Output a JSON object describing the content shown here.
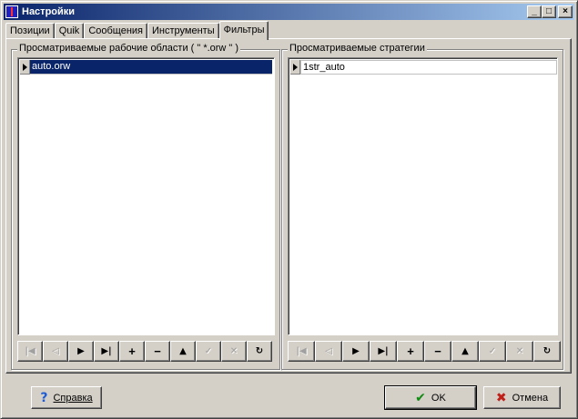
{
  "window": {
    "title": "Настройки",
    "controls": {
      "minimize": "_",
      "maximize": "□",
      "close": "×"
    }
  },
  "tabs": [
    {
      "label": "Позиции"
    },
    {
      "label": "Quik"
    },
    {
      "label": "Сообщения"
    },
    {
      "label": "Инструменты"
    },
    {
      "label": "Фильтры",
      "active": true
    }
  ],
  "left_panel": {
    "title": "Просматриваемые рабочие области  ( \" *.orw \" )",
    "rows": [
      "auto.orw"
    ]
  },
  "right_panel": {
    "title": "Просматриваемые стратегии",
    "rows": [
      "1str_auto"
    ]
  },
  "navigator": {
    "buttons": [
      {
        "name": "first-record",
        "glyph": "|◀",
        "enabled": false
      },
      {
        "name": "prior-record",
        "glyph": "◁",
        "enabled": false
      },
      {
        "name": "next-record",
        "glyph": "▶",
        "enabled": true
      },
      {
        "name": "last-record",
        "glyph": "▶|",
        "enabled": true
      },
      {
        "name": "insert-record",
        "glyph": "+",
        "enabled": true
      },
      {
        "name": "delete-record",
        "glyph": "−",
        "enabled": true
      },
      {
        "name": "edit-record",
        "glyph": "▲",
        "enabled": true
      },
      {
        "name": "post-record",
        "glyph": "✓",
        "enabled": false
      },
      {
        "name": "cancel-record",
        "glyph": "✕",
        "enabled": false
      },
      {
        "name": "refresh",
        "glyph": "↻",
        "enabled": true
      }
    ]
  },
  "footer": {
    "help_label": "Справка",
    "ok_label": "OK",
    "cancel_label": "Отмена",
    "help_icon": "?",
    "ok_icon": "✔",
    "cancel_icon": "✖"
  }
}
